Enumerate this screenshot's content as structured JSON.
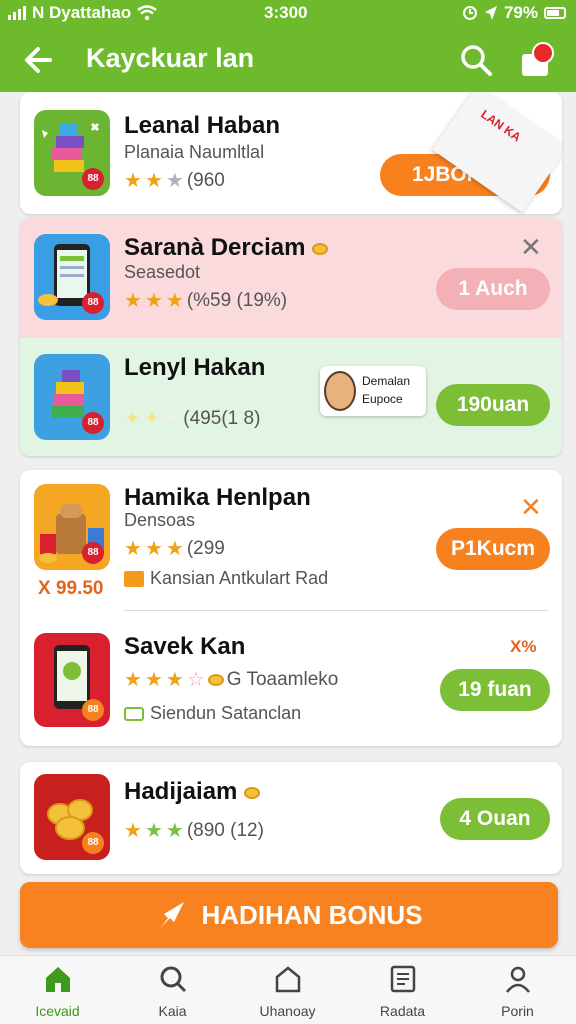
{
  "status_bar": {
    "carrier": "N Dyattahao",
    "time": "3:300",
    "battery": "79%"
  },
  "app_bar": {
    "title": "Kayckuar lan"
  },
  "ribbon": {
    "text": "LAN KA"
  },
  "items": [
    {
      "name": "Leanal Haban",
      "subtitle": "Planaia Naumltlal",
      "rating_text": "(960",
      "button": "1JBONAIN"
    },
    {
      "name": "Saranà Derciam",
      "subtitle": "Seasedot",
      "rating_text": "(%59 (19%)",
      "button": "1 Auch"
    },
    {
      "name": "Lenyl Hakan",
      "rating_text": "(495(1 8)",
      "tip_line1": "Demalan",
      "tip_line2": "Eupoce",
      "button": "190uan"
    },
    {
      "name": "Hamika Henlpan",
      "subtitle": "Densoas",
      "rating_text": "(299",
      "price": "X 99.50",
      "promo": "Kansian Antkulart Rad",
      "button": "P1Kucm"
    },
    {
      "name": "Savek Kan",
      "discount": "X%",
      "coin_text": "G Toaamleko",
      "promo": "Siendun Satanclan",
      "button": "19 fuan"
    },
    {
      "name": "Hadijaiam",
      "rating_text": "(890 (12)",
      "button": "4 Ouan"
    }
  ],
  "bonus_label": "HADIHAN BONUS",
  "nav": [
    {
      "label": "Icevaid"
    },
    {
      "label": "Kaia"
    },
    {
      "label": "Uhanoay"
    },
    {
      "label": "Radata"
    },
    {
      "label": "Porin"
    }
  ],
  "colors": {
    "brand_green": "#6dbb2c",
    "accent_orange": "#f7801f",
    "button_green": "#7cbf36"
  }
}
